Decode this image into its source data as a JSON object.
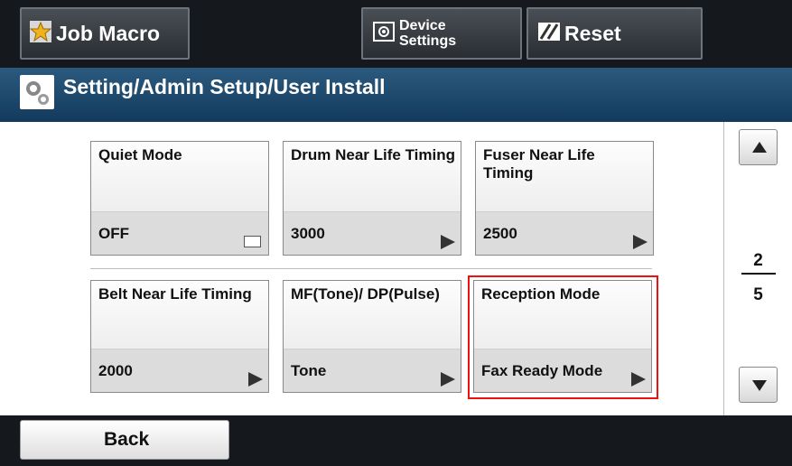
{
  "toolbar": {
    "job_macro_label": "Job Macro",
    "device_settings_line1": "Device",
    "device_settings_line2": "Settings",
    "reset_label": "Reset"
  },
  "title_bar": {
    "title": "Setting/Admin Setup/User Install"
  },
  "tiles": [
    {
      "name": "Quiet Mode",
      "value": "OFF"
    },
    {
      "name": "Drum Near Life Timing",
      "value": "3000"
    },
    {
      "name": "Fuser Near Life Timing",
      "value": "2500"
    },
    {
      "name": "Belt Near Life Timing",
      "value": "2000"
    },
    {
      "name": "MF(Tone)/ DP(Pulse)",
      "value": "Tone"
    },
    {
      "name": "Reception Mode",
      "value": "Fax Ready Mode"
    }
  ],
  "pager": {
    "current": "2",
    "total": "5"
  },
  "footer": {
    "back_label": "Back"
  },
  "colors": {
    "selection_border": "#e11111",
    "bar_background": "#15191d",
    "title_bar": "#1f4a6e"
  }
}
